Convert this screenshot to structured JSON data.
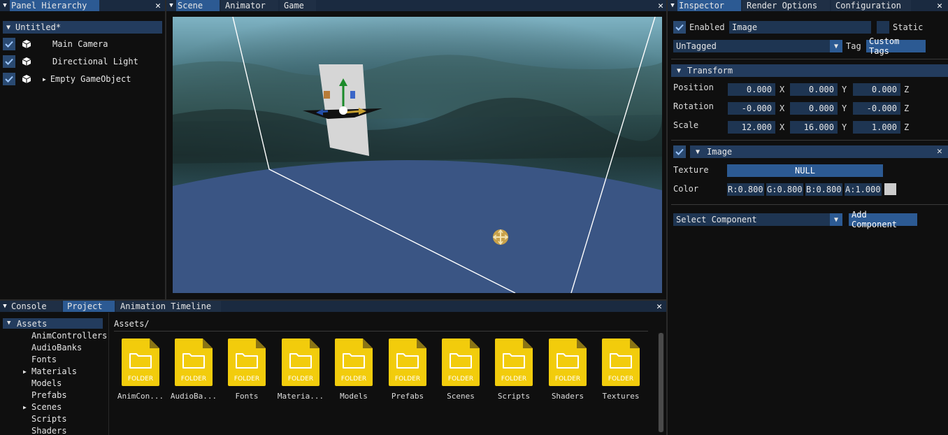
{
  "hierarchy": {
    "tab": "Panel Hierarchy",
    "root": "Untitled*",
    "items": [
      {
        "label": "Main Camera"
      },
      {
        "label": "Directional Light"
      },
      {
        "label": "Empty GameObject"
      }
    ]
  },
  "scene": {
    "tabs": [
      "Scene",
      "Animator",
      "Game"
    ]
  },
  "inspector": {
    "tabs": [
      "Inspector",
      "Render Options",
      "Configuration"
    ],
    "enabled_label": "Enabled",
    "name_value": "Image",
    "static_label": "Static",
    "tag_value": "UnTagged",
    "tag_label": "Tag",
    "custom_tags_button": "Custom Tags",
    "transform": {
      "header": "Transform",
      "rows": [
        {
          "label": "Position",
          "x": "0.000",
          "y": "0.000",
          "z": "0.000"
        },
        {
          "label": "Rotation",
          "x": "-0.000",
          "y": "0.000",
          "z": "-0.000"
        },
        {
          "label": "Scale",
          "x": "12.000",
          "y": "16.000",
          "z": "1.000"
        }
      ],
      "axis_x": "X",
      "axis_y": "Y",
      "axis_z": "Z"
    },
    "image": {
      "header": "Image",
      "texture_label": "Texture",
      "texture_value": "NULL",
      "color_label": "Color",
      "r": "R:0.800",
      "g": "G:0.800",
      "b": "B:0.800",
      "a": "A:1.000",
      "swatch": "#cccccc"
    },
    "select_component": "Select Component",
    "add_component": "Add Component"
  },
  "bottom": {
    "tabs": [
      "Console",
      "Project",
      "Animation Timeline"
    ],
    "tree_root": "Assets",
    "tree": [
      "AnimControllers",
      "AudioBanks",
      "Fonts",
      "Materials",
      "Models",
      "Prefabs",
      "Scenes",
      "Scripts",
      "Shaders"
    ],
    "path": "Assets/",
    "folder_badge": "FOLDER",
    "folders": [
      "AnimCon...",
      "AudioBa...",
      "Fonts",
      "Materia...",
      "Models",
      "Prefabs",
      "Scenes",
      "Scripts",
      "Shaders",
      "Textures"
    ]
  },
  "colors": {
    "accent": "#2c5a93",
    "folder": "#f2cc0c"
  }
}
